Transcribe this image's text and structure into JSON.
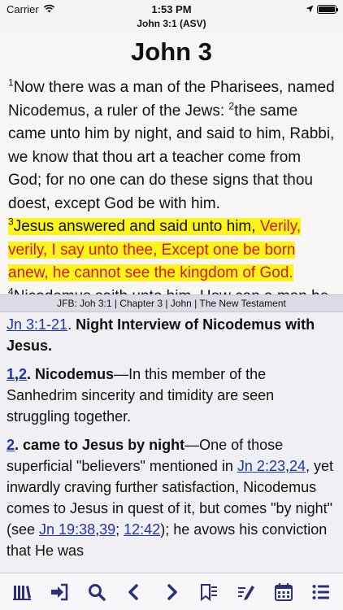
{
  "status": {
    "carrier": "Carrier",
    "time": "1:53 PM"
  },
  "header": {
    "reference": "John 3:1 (ASV)"
  },
  "bible": {
    "chapter_title": "John 3",
    "v1_num": "1",
    "v1_text": "Now there was a man of the Pharisees, named Nicodemus, a ruler of the Jews: ",
    "v2_num": "2",
    "v2_text": "the same came unto him by night, and said to him, Rabbi, we know that thou art a teacher come from God; for no one can do these signs that thou doest, except God be with him.",
    "v3_num": "3",
    "v3_text_black": "Jesus answered and said unto him, ",
    "v3_text_red": "Verily, verily, I say unto thee, Except one be born anew, he cannot see the kingdom of God.",
    "v4_num": "4",
    "v4_text": "Nicodemus saith unto him, How can a man be born when he is old? can he enter a second time into his mother's womb, and be born?"
  },
  "commentary_bar": {
    "label": "JFB: Joh 3:1 | Chapter 3 | John | The New Testament"
  },
  "commentary": {
    "p1_link": "Jn 3:1-21",
    "p1_after_link": ". ",
    "p1_heading": "Night Interview of Nicodemus with Jesus.",
    "p2_link1": "1",
    "p2_comma": ",",
    "p2_link2": "2",
    "p2_heading": ". Nicodemus",
    "p2_text": "—In this member of the Sanhedrim sincerity and timidity are seen struggling together.",
    "p3_link": "2",
    "p3_heading": ". came to Jesus by night",
    "p3_text1": "—One of those superficial \"believers\" mentioned in ",
    "p3_link_a": "Jn 2:23",
    "p3_comma1": ",",
    "p3_link_b": "24",
    "p3_text2": ", yet inwardly craving further satisfaction, Nicodemus comes to Jesus in quest of it, but comes \"by night\" (see ",
    "p3_link_c": "Jn 19:38",
    "p3_comma2": ",",
    "p3_link_d": "39",
    "p3_semicolon": "; ",
    "p3_link_e": "12:42",
    "p3_text3": "); he avows his conviction that He was"
  },
  "colors": {
    "accent": "#2e2f7a",
    "highlight": "#fff41a",
    "words_of_christ": "#d01818",
    "link": "#2233aa"
  },
  "toolbar": {
    "icons": [
      "library-icon",
      "sign-in-icon",
      "search-icon",
      "back-icon",
      "forward-icon",
      "bookmark-icon",
      "edit-note-icon",
      "calendar-icon",
      "menu-icon"
    ]
  }
}
